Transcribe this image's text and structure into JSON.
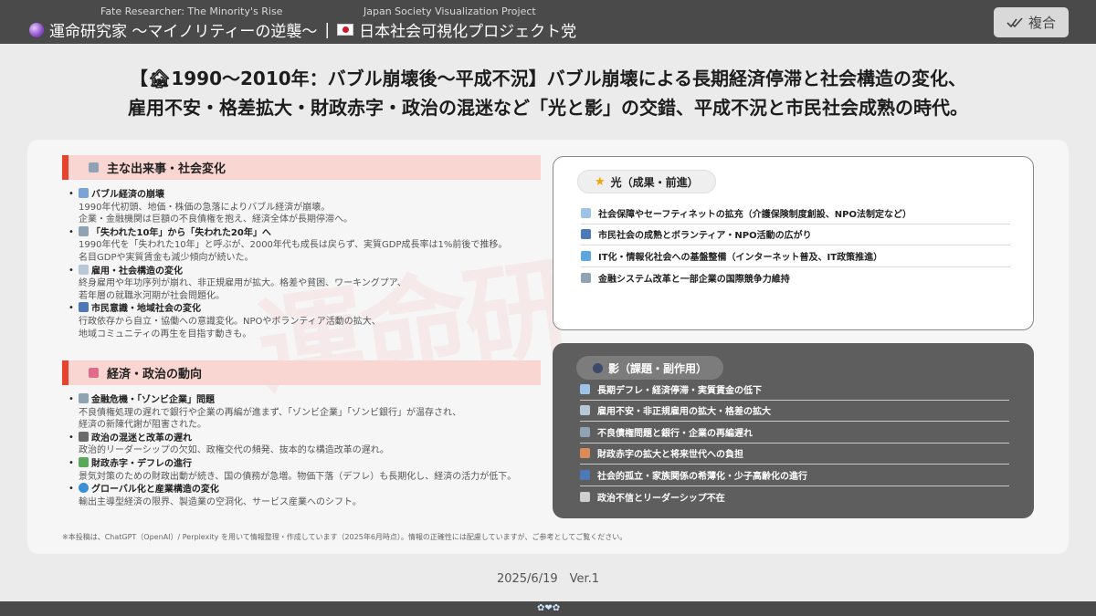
{
  "header": {
    "subtitle_left": "Fate Researcher: The Minority's Rise",
    "subtitle_right": "Japan Society Visualization Project",
    "title_left": "運命研究家 〜マイノリティーの逆襲〜",
    "separator": "|",
    "title_right": "日本社会可視化プロジェクト党",
    "copy_label": "複合",
    "copy_icon": "checkmark-icon"
  },
  "headline": {
    "line1": "【🏚1990〜2010年：バブル崩壊後〜平成不況】バブル崩壊による長期経済停滞と社会構造の変化、",
    "line2": "雇用不安・格差拡大・財政赤字・政治の混迷など「光と影」の交錯、平成不況と市民社会成熟の時代。"
  },
  "watermark": "運命研",
  "main_events": {
    "heading": "主な出来事・社会変化",
    "heading_icon": "bank-icon",
    "items": [
      {
        "title": "バブル経済の崩壊",
        "icon": "chart-down-icon",
        "lines": [
          "1990年代初頭、地価・株価の急落によりバブル経済が崩壊。",
          "企業・金融機関は巨額の不良債権を抱え、経済全体が長期停滞へ。"
        ]
      },
      {
        "title": "「失われた10年」から「失われた20年」へ",
        "icon": "bank-icon",
        "lines": [
          "1990年代を「失われた10年」と呼ぶが、2000年代も成長は戻らず、実質GDP成長率は1%前後で推移。",
          "名目GDPや実質賃金も減少傾向が続いた。"
        ]
      },
      {
        "title": "雇用・社会構造の変化",
        "icon": "office-icon",
        "lines": [
          "終身雇用や年功序列が崩れ、非正規雇用が拡大。格差や貧困、ワーキングプア、",
          "若年層の就職氷河期が社会問題化。"
        ]
      },
      {
        "title": "市民意識・地域社会の変化",
        "icon": "people-icon",
        "lines": [
          "行政依存から自立・協働への意識変化。NPOやボランティア活動の拡大、",
          "地域コミュニティの再生を目指す動きも。"
        ]
      }
    ]
  },
  "economy": {
    "heading": "経済・政治の動向",
    "heading_icon": "chart-up-icon",
    "items": [
      {
        "title": "金融危機・「ゾンビ企業」問題",
        "icon": "bank-icon",
        "lines": [
          "不良債権処理の遅れで銀行や企業の再編が進まず、「ゾンビ企業」「ゾンビ銀行」が温存され、",
          "経済の新陳代謝が阻害された。"
        ]
      },
      {
        "title": "政治の混迷と改革の遅れ",
        "icon": "government-icon",
        "lines": [
          "政治的リーダーシップの欠如、政権交代の頻発、抜本的な構造改革の遅れ。"
        ]
      },
      {
        "title": "財政赤字・デフレの進行",
        "icon": "money-icon",
        "lines": [
          "景気対策のための財政出動が続き、国の債務が急増。物価下落（デフレ）も長期化し、経済の活力が低下。"
        ]
      },
      {
        "title": "グローバル化と産業構造の変化",
        "icon": "globe-icon",
        "lines": [
          "輸出主導型経済の限界、製造業の空洞化、サービス産業へのシフト。"
        ]
      }
    ]
  },
  "light": {
    "heading": "光（成果・前進）",
    "heading_icon": "star-icon",
    "rows": [
      {
        "text": "社会保障やセーフティネットの拡充（介護保険制度創設、NPO法制定など）",
        "icon": "hospital-icon"
      },
      {
        "text": "市民社会の成熟とボランティア・NPO活動の広がり",
        "icon": "people-icon"
      },
      {
        "text": "IT化・情報化社会への基盤整備（インターネット普及、IT政策推進）",
        "icon": "computer-icon"
      },
      {
        "text": "金融システム改革と一部企業の国際競争力維持",
        "icon": "bank-icon"
      }
    ]
  },
  "shadow": {
    "heading": "影（課題・副作用）",
    "heading_icon": "moon-icon",
    "rows": [
      {
        "text": "長期デフレ・経済停滞・実質賃金の低下",
        "icon": "chart-down-icon"
      },
      {
        "text": "雇用不安・非正規雇用の拡大・格差の拡大",
        "icon": "office-icon"
      },
      {
        "text": "不良債権問題と銀行・企業の再編遅れ",
        "icon": "bank-icon"
      },
      {
        "text": "財政赤字の拡大と将来世代への負担",
        "icon": "house-icon"
      },
      {
        "text": "社会的孤立・家族関係の希薄化・少子高齢化の進行",
        "icon": "people-icon"
      },
      {
        "text": "政治不信とリーダーシップ不在",
        "icon": "government-icon"
      }
    ]
  },
  "footnote": "※本投稿は、ChatGPT（OpenAI）/ Perplexity を用いて情報整理・作成しています（2025年6月時点）。情報の正確性には配慮していますが、ご参考としてご覧ください。",
  "date": "2025/6/19　Ver.1",
  "bottom_deco": "✿❤✿",
  "colors": {
    "accent": "#e8432f",
    "section_bg": "#f9d6d2",
    "dark": "#4a4a4a",
    "shadow_bg": "#5e5e5e"
  }
}
